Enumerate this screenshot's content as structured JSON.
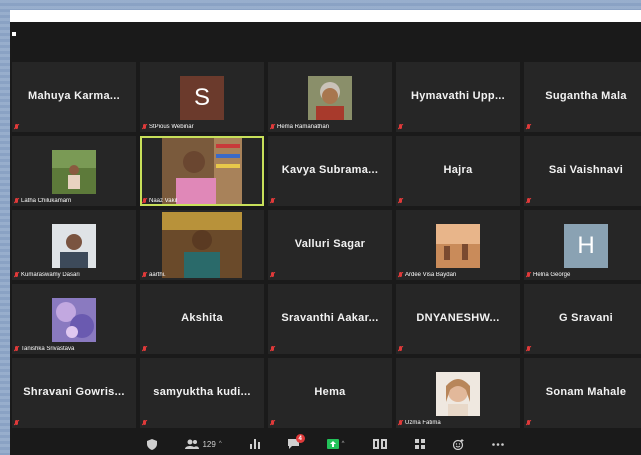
{
  "participants_count": "129",
  "chat_badge": "4",
  "tiles": [
    {
      "kind": "name",
      "name": "Mahuya Karma..."
    },
    {
      "kind": "letter",
      "letter": "S",
      "color": "#6b3a2c",
      "label": "StPious Webinar"
    },
    {
      "kind": "photo",
      "label": "Hema Ramanathan",
      "photo": "hema"
    },
    {
      "kind": "name",
      "name": "Hymavathi Upp..."
    },
    {
      "kind": "name",
      "name": "Sugantha Mala"
    },
    {
      "kind": "photo",
      "label": "Latha Chilukamarri",
      "photo": "latha"
    },
    {
      "kind": "video",
      "label": "Naaz Vakil",
      "active": true
    },
    {
      "kind": "name",
      "name": "Kavya Subrama..."
    },
    {
      "kind": "name",
      "name": "Hajra"
    },
    {
      "kind": "name",
      "name": "Sai Vaishnavi"
    },
    {
      "kind": "photo",
      "label": "Kumaraswamy Dasari",
      "photo": "kumar"
    },
    {
      "kind": "video2",
      "label": "aarthi."
    },
    {
      "kind": "name",
      "name": "Valluri Sagar"
    },
    {
      "kind": "photo",
      "label": "Ardee Visa Baydan",
      "photo": "ardee"
    },
    {
      "kind": "letter",
      "letter": "H",
      "color": "#8aa2b3",
      "label": "Helna George"
    },
    {
      "kind": "photo",
      "label": "Tanishka Srivastava",
      "photo": "tanishka"
    },
    {
      "kind": "name",
      "name": "Akshita"
    },
    {
      "kind": "name",
      "name": "Sravanthi Aakar..."
    },
    {
      "kind": "name",
      "name": "DNYANESHW..."
    },
    {
      "kind": "name",
      "name": "G Sravani"
    },
    {
      "kind": "name",
      "name": "Shravani Gowris..."
    },
    {
      "kind": "name",
      "name": "samyuktha kudi..."
    },
    {
      "kind": "name",
      "name": "Hema"
    },
    {
      "kind": "photo",
      "label": "Uzma Fatima",
      "photo": "uzma"
    },
    {
      "kind": "name",
      "name": "Sonam Mahale"
    }
  ],
  "toolbar": [
    {
      "icon": "security-icon"
    },
    {
      "icon": "participants-icon",
      "count": "129",
      "caret": true
    },
    {
      "icon": "polls-icon"
    },
    {
      "icon": "chat-icon",
      "badge": "4"
    },
    {
      "icon": "share-screen-icon",
      "caret": true
    },
    {
      "icon": "record-icon"
    },
    {
      "icon": "breakout-rooms-icon"
    },
    {
      "icon": "reactions-icon"
    },
    {
      "icon": "more-icon"
    }
  ]
}
